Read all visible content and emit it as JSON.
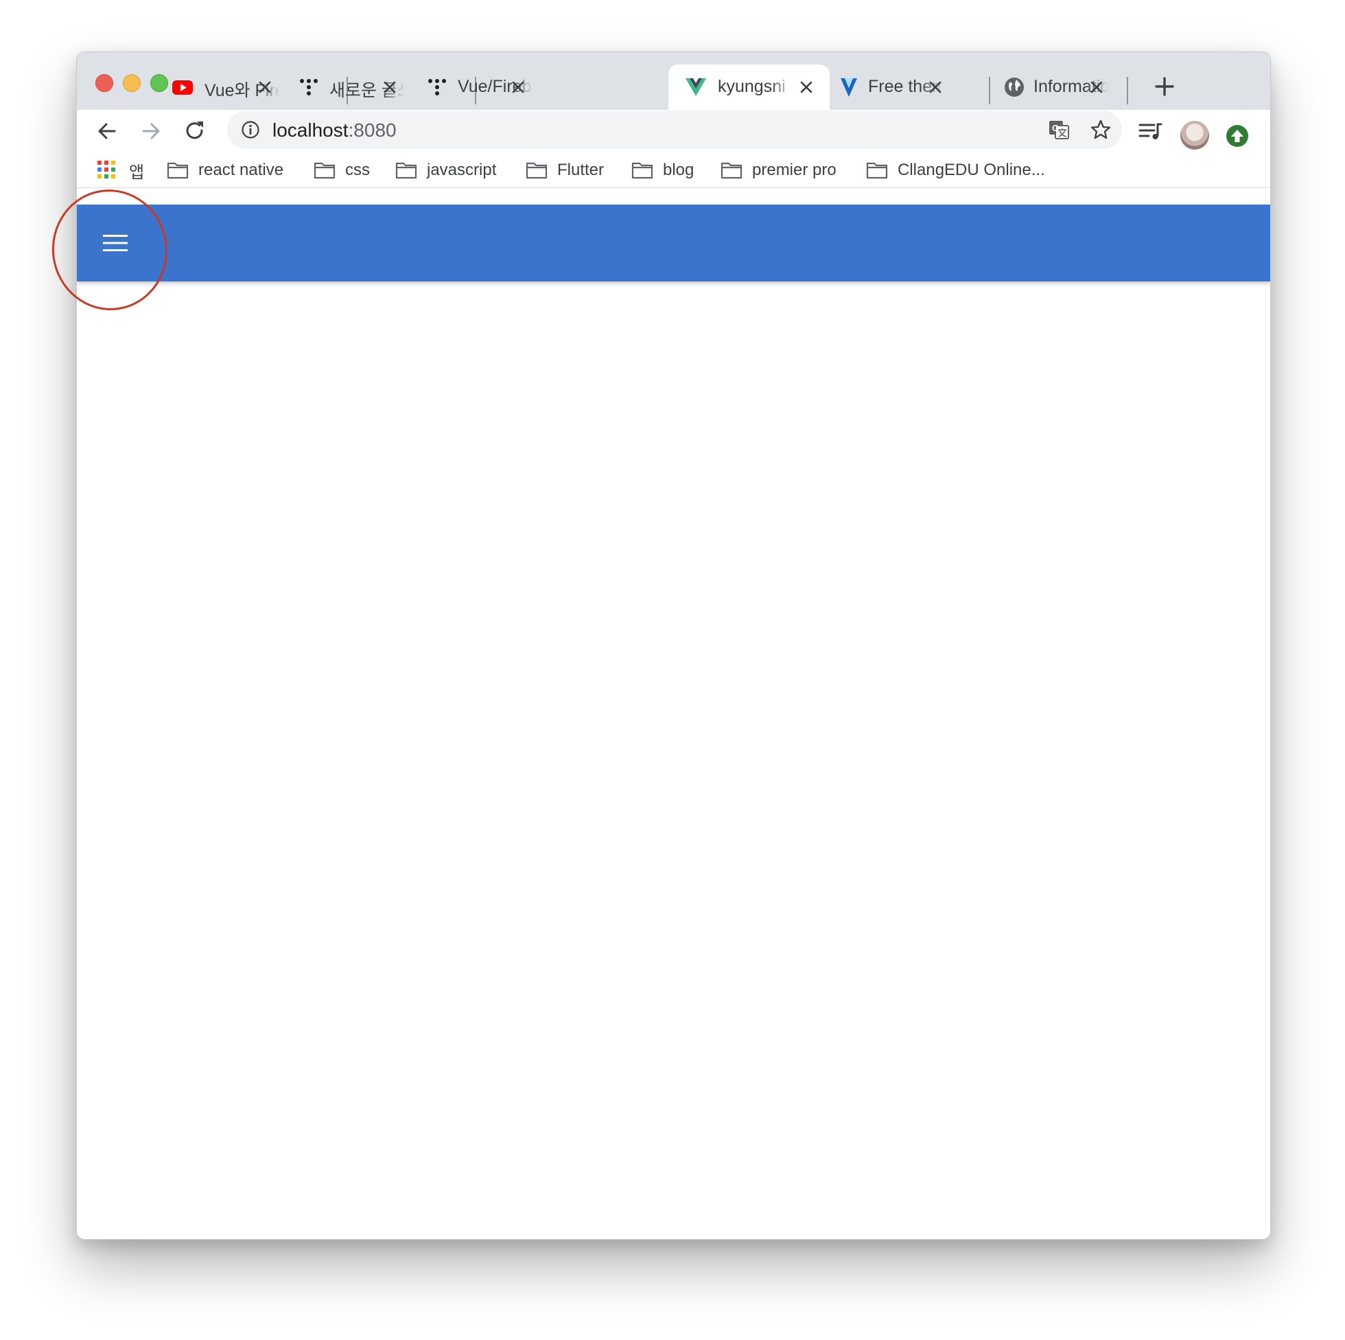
{
  "browser": {
    "tabs": [
      {
        "title": "Vue와 Fire",
        "icon": "youtube-icon",
        "active": false
      },
      {
        "title": "새로운 글쓰",
        "icon": "dots-icon",
        "active": false
      },
      {
        "title": "Vue/Fireb",
        "icon": "dots-icon",
        "active": false
      },
      {
        "title": "kyungsni",
        "icon": "vue-icon",
        "active": true
      },
      {
        "title": "Free them",
        "icon": "vuetify-icon",
        "active": false
      },
      {
        "title": "Informatio",
        "icon": "globe-icon",
        "active": false
      }
    ],
    "address": {
      "host": "localhost",
      "port": ":8080"
    },
    "bookmarks": {
      "apps_label": "앱",
      "items": [
        {
          "label": "react native"
        },
        {
          "label": "css"
        },
        {
          "label": "javascript"
        },
        {
          "label": "Flutter"
        },
        {
          "label": "blog"
        },
        {
          "label": "premier pro"
        },
        {
          "label": "CllangEDU Online..."
        }
      ]
    }
  },
  "page": {
    "appbar_color": "#3b74cd",
    "menu_icon": "hamburger-menu-icon"
  },
  "annotation": {
    "color": "#c83a26",
    "shape": "circle around menu button"
  }
}
